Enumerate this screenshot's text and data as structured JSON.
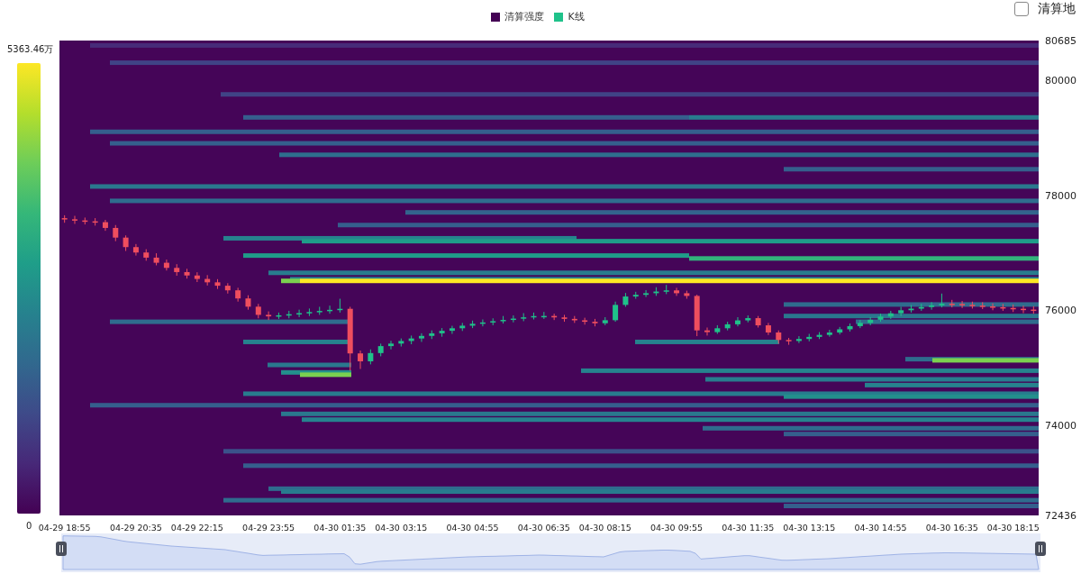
{
  "legend": {
    "items": [
      {
        "label": "清算强度",
        "color": "#440154"
      },
      {
        "label": "K线",
        "color": "#1fc28a"
      }
    ]
  },
  "map_toggle": {
    "label": "清算地",
    "checked": false
  },
  "color_scale": {
    "max_label": "5363.46万",
    "min_label": "0"
  },
  "zoom_slider": {
    "level": 1
  },
  "price_chart": {
    "chart_data": {
      "type": "candlestick",
      "ylim": [
        72436,
        80685
      ],
      "yticks": [
        {
          "value": 80685,
          "label": "80685"
        },
        {
          "value": 80000,
          "label": "80000"
        },
        {
          "value": 78000,
          "label": "78000"
        },
        {
          "value": 76000,
          "label": "76000"
        },
        {
          "value": 74000,
          "label": "74000"
        },
        {
          "value": 72436,
          "label": "72436"
        }
      ],
      "categories": [
        "04-29 18:55",
        null,
        null,
        null,
        null,
        null,
        null,
        "04-29 20:35",
        null,
        null,
        null,
        null,
        null,
        "04-29 22:15",
        null,
        null,
        null,
        null,
        null,
        null,
        "04-29 23:55",
        null,
        null,
        null,
        null,
        null,
        null,
        "04-30 01:35",
        null,
        null,
        null,
        null,
        null,
        "04-30 03:15",
        null,
        null,
        null,
        null,
        null,
        null,
        "04-30 04:55",
        null,
        null,
        null,
        null,
        null,
        null,
        "04-30 06:35",
        null,
        null,
        null,
        null,
        null,
        "04-30 08:15",
        null,
        null,
        null,
        null,
        null,
        null,
        "04-30 09:55",
        null,
        null,
        null,
        null,
        null,
        null,
        "04-30 11:35",
        null,
        null,
        null,
        null,
        null,
        "04-30 13:15",
        null,
        null,
        null,
        null,
        null,
        null,
        "04-30 14:55",
        null,
        null,
        null,
        null,
        null,
        null,
        "04-30 16:35",
        null,
        null,
        null,
        null,
        null,
        "04-30 18:15",
        null,
        null
      ],
      "ohlc": [
        [
          77600,
          77650,
          77520,
          77580
        ],
        [
          77580,
          77640,
          77500,
          77560
        ],
        [
          77560,
          77610,
          77490,
          77545
        ],
        [
          77545,
          77600,
          77470,
          77530
        ],
        [
          77530,
          77570,
          77380,
          77430
        ],
        [
          77430,
          77480,
          77200,
          77262
        ],
        [
          77262,
          77300,
          77030,
          77097
        ],
        [
          77097,
          77150,
          76950,
          77003
        ],
        [
          77003,
          77060,
          76860,
          76914
        ],
        [
          76914,
          76990,
          76780,
          76825
        ],
        [
          76825,
          76880,
          76690,
          76736
        ],
        [
          76736,
          76800,
          76600,
          76663
        ],
        [
          76663,
          76720,
          76550,
          76604
        ],
        [
          76604,
          76660,
          76490,
          76544
        ],
        [
          76544,
          76610,
          76430,
          76485
        ],
        [
          76485,
          76540,
          76370,
          76426
        ],
        [
          76426,
          76470,
          76290,
          76346
        ],
        [
          76346,
          76390,
          76150,
          76205
        ],
        [
          76205,
          76260,
          76010,
          76062
        ],
        [
          76062,
          76110,
          75860,
          75920
        ],
        [
          75920,
          75980,
          75830,
          75894
        ],
        [
          75894,
          75960,
          75850,
          75912
        ],
        [
          75912,
          75990,
          75860,
          75931
        ],
        [
          75931,
          76010,
          75880,
          75950
        ],
        [
          75950,
          76030,
          75900,
          75969
        ],
        [
          75969,
          76060,
          75920,
          75988
        ],
        [
          75988,
          76080,
          75940,
          76007
        ],
        [
          76007,
          76200,
          75960,
          76025
        ],
        [
          76025,
          76060,
          74950,
          75250
        ],
        [
          75250,
          75300,
          74980,
          75113
        ],
        [
          75113,
          75320,
          75060,
          75256
        ],
        [
          75256,
          75420,
          75200,
          75377
        ],
        [
          75377,
          75470,
          75320,
          75421
        ],
        [
          75421,
          75510,
          75370,
          75466
        ],
        [
          75466,
          75560,
          75410,
          75510
        ],
        [
          75510,
          75600,
          75450,
          75554
        ],
        [
          75554,
          75650,
          75500,
          75599
        ],
        [
          75599,
          75690,
          75540,
          75643
        ],
        [
          75643,
          75730,
          75590,
          75687
        ],
        [
          75687,
          75780,
          75640,
          75732
        ],
        [
          75732,
          75820,
          75690,
          75765
        ],
        [
          75765,
          75840,
          75720,
          75788
        ],
        [
          75788,
          75860,
          75740,
          75810
        ],
        [
          75810,
          75900,
          75770,
          75832
        ],
        [
          75832,
          75910,
          75790,
          75855
        ],
        [
          75855,
          75950,
          75810,
          75877
        ],
        [
          75877,
          75960,
          75840,
          75899
        ],
        [
          75899,
          75970,
          75850,
          75901
        ],
        [
          75901,
          75940,
          75830,
          75876
        ],
        [
          75876,
          75920,
          75800,
          75850
        ],
        [
          75850,
          75900,
          75780,
          75825
        ],
        [
          75825,
          75870,
          75750,
          75800
        ],
        [
          75800,
          75850,
          75720,
          75774
        ],
        [
          75774,
          75880,
          75740,
          75827
        ],
        [
          75827,
          76150,
          75800,
          76093
        ],
        [
          76093,
          76300,
          76060,
          76239
        ],
        [
          76239,
          76320,
          76200,
          76268
        ],
        [
          76268,
          76350,
          76230,
          76296
        ],
        [
          76296,
          76400,
          76250,
          76325
        ],
        [
          76325,
          76440,
          76280,
          76345
        ],
        [
          76345,
          76390,
          76250,
          76296
        ],
        [
          76296,
          76340,
          76200,
          76249
        ],
        [
          76249,
          76270,
          75550,
          75650
        ],
        [
          75650,
          75700,
          75560,
          75620
        ],
        [
          75620,
          75740,
          75590,
          75687
        ],
        [
          75687,
          75800,
          75650,
          75756
        ],
        [
          75756,
          75880,
          75720,
          75824
        ],
        [
          75824,
          75910,
          75790,
          75863
        ],
        [
          75863,
          75900,
          75700,
          75738
        ],
        [
          75738,
          75780,
          75570,
          75614
        ],
        [
          75614,
          75650,
          75420,
          75484
        ],
        [
          75484,
          75520,
          75400,
          75466
        ],
        [
          75466,
          75550,
          75430,
          75501
        ],
        [
          75501,
          75590,
          75460,
          75537
        ],
        [
          75537,
          75620,
          75500,
          75572
        ],
        [
          75572,
          75660,
          75540,
          75613
        ],
        [
          75613,
          75710,
          75580,
          75669
        ],
        [
          75669,
          75770,
          75630,
          75724
        ],
        [
          75724,
          75830,
          75690,
          75780
        ],
        [
          75780,
          75880,
          75740,
          75835
        ],
        [
          75835,
          75940,
          75800,
          75891
        ],
        [
          75891,
          75990,
          75850,
          75947
        ],
        [
          75947,
          76060,
          75900,
          76000
        ],
        [
          76000,
          76090,
          75960,
          76028
        ],
        [
          76028,
          76110,
          75990,
          76056
        ],
        [
          76056,
          76140,
          76010,
          76085
        ],
        [
          76085,
          76290,
          76050,
          76113
        ],
        [
          76113,
          76180,
          76050,
          76108
        ],
        [
          76108,
          76160,
          76040,
          76094
        ],
        [
          76094,
          76150,
          76030,
          76081
        ],
        [
          76081,
          76140,
          76020,
          76067
        ],
        [
          76067,
          76120,
          76000,
          76053
        ],
        [
          76053,
          76110,
          75990,
          76040
        ],
        [
          76040,
          76100,
          75970,
          76026
        ],
        [
          76026,
          76080,
          75950,
          76012
        ],
        [
          76012,
          76070,
          75940,
          75998
        ]
      ]
    }
  }
}
